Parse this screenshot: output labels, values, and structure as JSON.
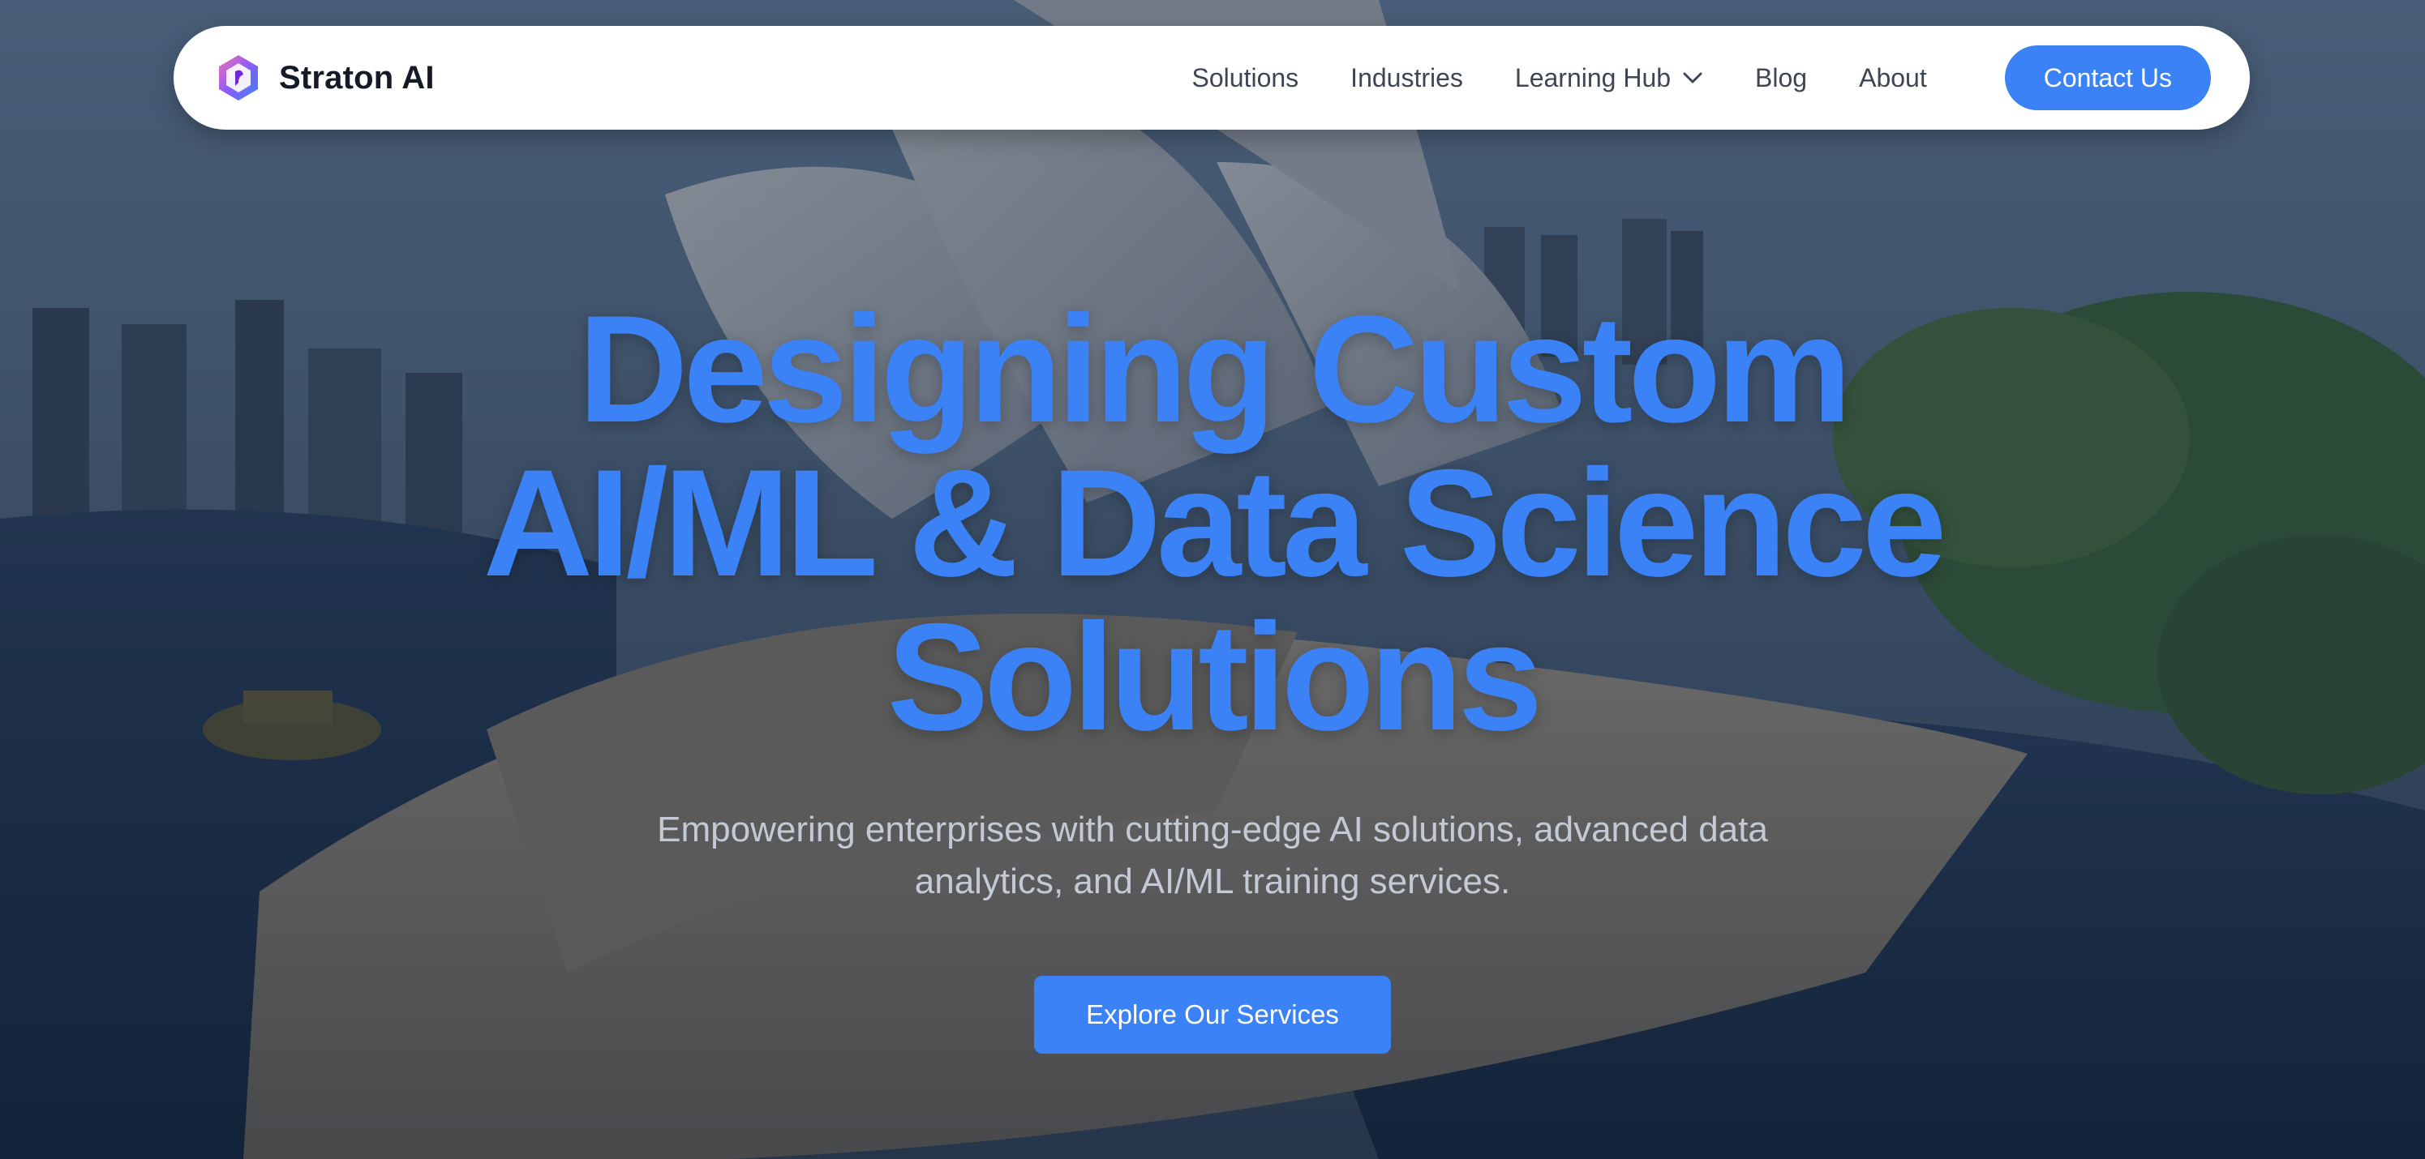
{
  "brand": {
    "name": "Straton AI",
    "logo_icon": "hexagon-logo-icon"
  },
  "nav": {
    "items": [
      {
        "label": "Solutions"
      },
      {
        "label": "Industries"
      },
      {
        "label": "Learning Hub",
        "icon": "chevron-down-icon"
      },
      {
        "label": "Blog"
      },
      {
        "label": "About"
      }
    ],
    "contact_label": "Contact Us"
  },
  "hero": {
    "headline_lines": [
      "Designing Custom",
      "AI/ML & Data Science",
      "Solutions"
    ],
    "subtitle_lines": [
      "Empowering enterprises with cutting-edge AI solutions, advanced data",
      "analytics, and AI/ML training services."
    ],
    "cta_label": "Explore Our Services"
  },
  "colors": {
    "accent": "#3b82f6",
    "nav_text": "#3f4653",
    "brand_text": "#141a26",
    "subtitle_text": "#c3cad6"
  }
}
